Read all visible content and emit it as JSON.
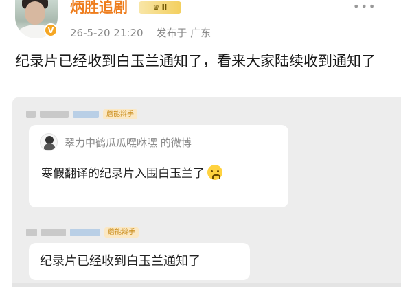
{
  "post": {
    "username": "炳胜追剧",
    "level_label": "Ⅱ",
    "verified_mark": "V",
    "timestamp": "26-5-20 21:20",
    "location": "发布于 广东",
    "more_icon": "more-icon",
    "text": "纪录片已经收到白玉兰通知了，看来大家陆续收到通知了"
  },
  "screenshot": {
    "first_sender_tag": "蘑能辩手",
    "quote": {
      "source_name": "翠力中鹤瓜瓜嘿咻嘿 的微博",
      "body": "寒假翻译的纪录片入围白玉兰了",
      "emoji": "crying-face-icon"
    },
    "second_sender_tag": "蘑能辩手",
    "reply": "纪录片已经收到白玉兰通知了"
  },
  "colors": {
    "username": "#ee7d1d",
    "tag_bg": "#fbe8c4",
    "tag_text": "#c98a16",
    "screenshot_bg": "#ededed"
  }
}
